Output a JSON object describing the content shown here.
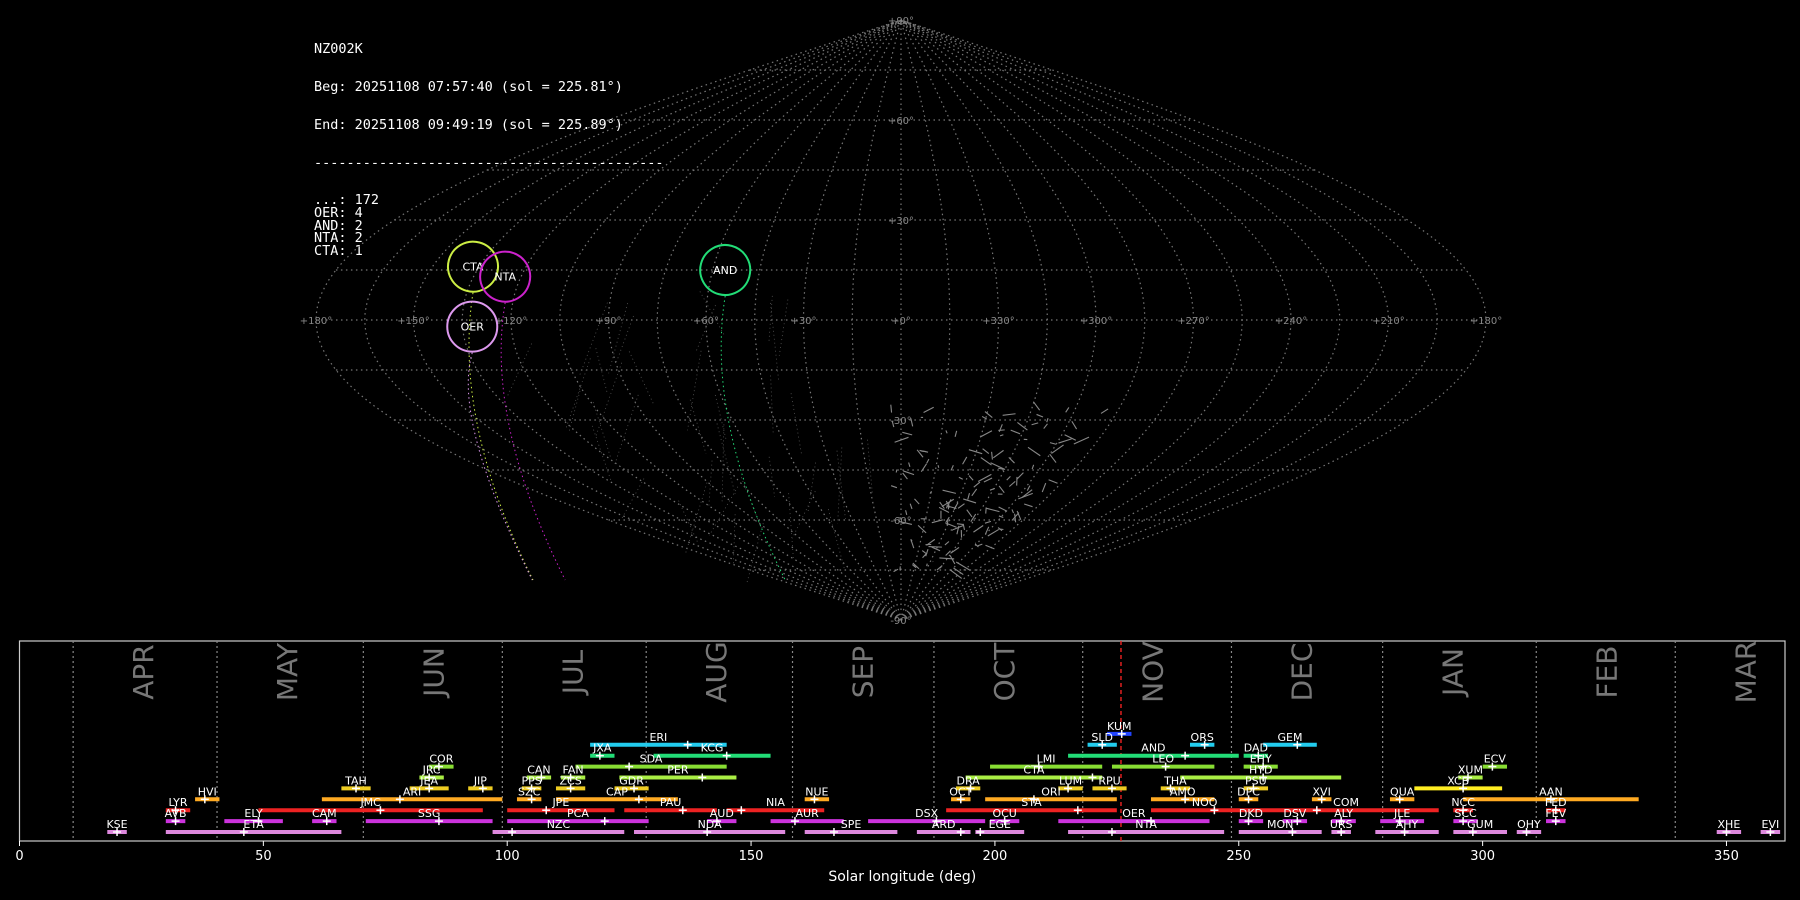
{
  "info": {
    "station": "NZ002K",
    "begin": "Beg: 20251108 07:57:40 (sol = 225.81°)",
    "end": "End: 20251108 09:49:19 (sol = 225.89°)",
    "separator": "-------------------------------------------",
    "counts": [
      {
        "code": "...",
        "count": 172
      },
      {
        "code": "OER",
        "count": 4
      },
      {
        "code": "AND",
        "count": 2
      },
      {
        "code": "NTA",
        "count": 2
      },
      {
        "code": "CTA",
        "count": 1
      }
    ]
  },
  "chart_data": [
    {
      "type": "scatter",
      "projection": "sinusoidal",
      "title": "",
      "lon_tick_labels": [
        "+180°",
        "+150°",
        "+120°",
        "+90°",
        "+60°",
        "+30°",
        "+0°",
        "+330°",
        "+300°",
        "+270°",
        "+240°",
        "+210°",
        "+180°"
      ],
      "lat_tick_labels": [
        "+90°",
        "+60°",
        "+30°",
        "-30°",
        "-60°",
        "-90°"
      ],
      "radiants": [
        {
          "code": "CTA",
          "lon": 137,
          "lat": 16,
          "color": "#ccee44"
        },
        {
          "code": "NTA",
          "lon": 125,
          "lat": 13,
          "color": "#cc22cc"
        },
        {
          "code": "AND",
          "lon": 56,
          "lat": 15,
          "color": "#22dd77"
        },
        {
          "code": "OER",
          "lon": 132,
          "lat": -2,
          "color": "#dd99ee"
        }
      ],
      "grid": true
    },
    {
      "type": "timeline",
      "xlabel": "Solar longitude (deg)",
      "xlim": [
        0,
        362
      ],
      "x_ticks": [
        0,
        50,
        100,
        150,
        200,
        250,
        300,
        350
      ],
      "current_sol": 225.85,
      "months": [
        {
          "name": "APR",
          "start": 11
        },
        {
          "name": "MAY",
          "start": 40.5
        },
        {
          "name": "JUN",
          "start": 70.5
        },
        {
          "name": "JUL",
          "start": 99
        },
        {
          "name": "AUG",
          "start": 128.5
        },
        {
          "name": "SEP",
          "start": 158.5
        },
        {
          "name": "OCT",
          "start": 187.5
        },
        {
          "name": "NOV",
          "start": 218
        },
        {
          "name": "DEC",
          "start": 248.5
        },
        {
          "name": "JAN",
          "start": 279.5
        },
        {
          "name": "FEB",
          "start": 311
        },
        {
          "name": "MAR",
          "start": 339.5
        }
      ],
      "showers": [
        {
          "code": "KUM",
          "start": 223,
          "end": 228,
          "peak": 226,
          "row": 13,
          "color": "#2244ff"
        },
        {
          "code": "ERI",
          "start": 117,
          "end": 145,
          "peak": 137,
          "row": 12,
          "color": "#22ccee"
        },
        {
          "code": "SLD",
          "start": 219,
          "end": 225,
          "peak": 222,
          "row": 12,
          "color": "#22ccee"
        },
        {
          "code": "ORS",
          "start": 240,
          "end": 245,
          "peak": 243,
          "row": 12,
          "color": "#22ccee"
        },
        {
          "code": "GEM",
          "start": 255,
          "end": 266,
          "peak": 262,
          "row": 12,
          "color": "#22ccee"
        },
        {
          "code": "JXA",
          "start": 117,
          "end": 122,
          "peak": 119,
          "row": 11,
          "color": "#22dd77"
        },
        {
          "code": "KCG",
          "start": 130,
          "end": 154,
          "peak": 145,
          "row": 11,
          "color": "#22dd77"
        },
        {
          "code": "AND",
          "start": 215,
          "end": 250,
          "peak": 239,
          "row": 11,
          "color": "#22dd77"
        },
        {
          "code": "DAD",
          "start": 251,
          "end": 256,
          "peak": 254,
          "row": 11,
          "color": "#22dd77"
        },
        {
          "code": "COR",
          "start": 84,
          "end": 89,
          "peak": 86,
          "row": 10,
          "color": "#88dd33"
        },
        {
          "code": "SDA",
          "start": 114,
          "end": 145,
          "peak": 125,
          "row": 10,
          "color": "#88dd33"
        },
        {
          "code": "LMI",
          "start": 199,
          "end": 222,
          "peak": 209,
          "row": 10,
          "color": "#88dd33"
        },
        {
          "code": "LEO",
          "start": 224,
          "end": 245,
          "peak": 235,
          "row": 10,
          "color": "#88dd33"
        },
        {
          "code": "EHY",
          "start": 251,
          "end": 258,
          "peak": 255,
          "row": 10,
          "color": "#88dd33"
        },
        {
          "code": "ECV",
          "start": 300,
          "end": 305,
          "peak": 302,
          "row": 10,
          "color": "#88dd33"
        },
        {
          "code": "JRC",
          "start": 82,
          "end": 87,
          "peak": 84,
          "row": 9,
          "color": "#aaee44"
        },
        {
          "code": "CAN",
          "start": 104,
          "end": 109,
          "peak": 107,
          "row": 9,
          "color": "#aaee44"
        },
        {
          "code": "FAN",
          "start": 111,
          "end": 116,
          "peak": 113,
          "row": 9,
          "color": "#aaee44"
        },
        {
          "code": "PER",
          "start": 123,
          "end": 147,
          "peak": 140,
          "row": 9,
          "color": "#aaee44"
        },
        {
          "code": "CTA",
          "start": 194,
          "end": 222,
          "peak": 220,
          "row": 9,
          "color": "#aaee44"
        },
        {
          "code": "HYD",
          "start": 238,
          "end": 271,
          "peak": 255,
          "row": 9,
          "color": "#aaee44"
        },
        {
          "code": "XUM",
          "start": 295,
          "end": 300,
          "peak": 297,
          "row": 9,
          "color": "#aaee44"
        },
        {
          "code": "TAH",
          "start": 66,
          "end": 72,
          "peak": 69,
          "row": 8,
          "color": "#eecc22"
        },
        {
          "code": "JEA",
          "start": 80,
          "end": 88,
          "peak": 84,
          "row": 8,
          "color": "#eecc22"
        },
        {
          "code": "JIP",
          "start": 92,
          "end": 97,
          "peak": 95,
          "row": 8,
          "color": "#eecc22"
        },
        {
          "code": "PPS",
          "start": 103,
          "end": 107,
          "peak": 105,
          "row": 8,
          "color": "#eecc22"
        },
        {
          "code": "ZCS",
          "start": 110,
          "end": 116,
          "peak": 113,
          "row": 8,
          "color": "#eecc22"
        },
        {
          "code": "GDR",
          "start": 122,
          "end": 129,
          "peak": 126,
          "row": 8,
          "color": "#eecc22"
        },
        {
          "code": "DRA",
          "start": 192,
          "end": 197,
          "peak": 195,
          "row": 8,
          "color": "#eecc22"
        },
        {
          "code": "LUM",
          "start": 213,
          "end": 218,
          "peak": 215,
          "row": 8,
          "color": "#eecc22"
        },
        {
          "code": "RPU",
          "start": 220,
          "end": 227,
          "peak": 224,
          "row": 8,
          "color": "#eecc22"
        },
        {
          "code": "THA",
          "start": 234,
          "end": 240,
          "peak": 236,
          "row": 8,
          "color": "#eecc22"
        },
        {
          "code": "PSU",
          "start": 251,
          "end": 256,
          "peak": 253,
          "row": 8,
          "color": "#eecc22"
        },
        {
          "code": "XCB",
          "start": 286,
          "end": 304,
          "peak": 296,
          "row": 8,
          "color": "#ffee22"
        },
        {
          "code": "HVI",
          "start": 36,
          "end": 41,
          "peak": 38,
          "row": 7,
          "color": "#ffaa22"
        },
        {
          "code": "ARI",
          "start": 62,
          "end": 99,
          "peak": 78,
          "row": 7,
          "color": "#ffaa22"
        },
        {
          "code": "SZC",
          "start": 102,
          "end": 107,
          "peak": 105,
          "row": 7,
          "color": "#ffaa22"
        },
        {
          "code": "CAP",
          "start": 110,
          "end": 135,
          "peak": 127,
          "row": 7,
          "color": "#ffaa22"
        },
        {
          "code": "NUE",
          "start": 161,
          "end": 166,
          "peak": 163,
          "row": 7,
          "color": "#ffaa22"
        },
        {
          "code": "OCT",
          "start": 191,
          "end": 195,
          "peak": 193,
          "row": 7,
          "color": "#ffaa22"
        },
        {
          "code": "ORI",
          "start": 198,
          "end": 225,
          "peak": 208,
          "row": 7,
          "color": "#ffaa22"
        },
        {
          "code": "AMO",
          "start": 232,
          "end": 245,
          "peak": 239,
          "row": 7,
          "color": "#ffaa22"
        },
        {
          "code": "DPC",
          "start": 250,
          "end": 254,
          "peak": 252,
          "row": 7,
          "color": "#ffaa22"
        },
        {
          "code": "XVI",
          "start": 265,
          "end": 269,
          "peak": 267,
          "row": 7,
          "color": "#ffaa22"
        },
        {
          "code": "QUA",
          "start": 281,
          "end": 286,
          "peak": 283,
          "row": 7,
          "color": "#ffaa22"
        },
        {
          "code": "AAN",
          "start": 296,
          "end": 332,
          "peak": 314,
          "row": 7,
          "color": "#ffaa22"
        },
        {
          "code": "LYR",
          "start": 30,
          "end": 35,
          "peak": 32,
          "row": 6,
          "color": "#ee2222"
        },
        {
          "code": "JMC",
          "start": 49,
          "end": 95,
          "peak": 74,
          "row": 6,
          "color": "#ee2222"
        },
        {
          "code": "JPE",
          "start": 100,
          "end": 122,
          "peak": 108,
          "row": 6,
          "color": "#ee2222"
        },
        {
          "code": "PAU",
          "start": 124,
          "end": 143,
          "peak": 136,
          "row": 6,
          "color": "#ee2222"
        },
        {
          "code": "NIA",
          "start": 145,
          "end": 165,
          "peak": 148,
          "row": 6,
          "color": "#ee2222"
        },
        {
          "code": "STA",
          "start": 190,
          "end": 225,
          "peak": 217,
          "row": 6,
          "color": "#ee2222"
        },
        {
          "code": "NOO",
          "start": 232,
          "end": 254,
          "peak": 245,
          "row": 6,
          "color": "#ee2222"
        },
        {
          "code": "COM",
          "start": 253,
          "end": 291,
          "peak": 266,
          "row": 6,
          "color": "#ee2222"
        },
        {
          "code": "NCC",
          "start": 294,
          "end": 298,
          "peak": 296,
          "row": 6,
          "color": "#ee2222"
        },
        {
          "code": "FED",
          "start": 313,
          "end": 317,
          "peak": 315,
          "row": 6,
          "color": "#ee2222"
        },
        {
          "code": "AVB",
          "start": 30,
          "end": 34,
          "peak": 32,
          "row": 5,
          "color": "#cc33dd"
        },
        {
          "code": "ELY",
          "start": 42,
          "end": 54,
          "peak": 49,
          "row": 5,
          "color": "#cc33dd"
        },
        {
          "code": "CAM",
          "start": 60,
          "end": 65,
          "peak": 63,
          "row": 5,
          "color": "#cc33dd"
        },
        {
          "code": "SSG",
          "start": 71,
          "end": 97,
          "peak": 86,
          "row": 5,
          "color": "#cc33dd"
        },
        {
          "code": "PCA",
          "start": 100,
          "end": 129,
          "peak": 120,
          "row": 5,
          "color": "#cc33dd"
        },
        {
          "code": "AUD",
          "start": 141,
          "end": 147,
          "peak": 143,
          "row": 5,
          "color": "#cc33dd"
        },
        {
          "code": "AUR",
          "start": 154,
          "end": 169,
          "peak": 159,
          "row": 5,
          "color": "#cc33dd"
        },
        {
          "code": "DSX",
          "start": 174,
          "end": 198,
          "peak": 188,
          "row": 5,
          "color": "#cc33dd"
        },
        {
          "code": "OCU",
          "start": 199,
          "end": 205,
          "peak": 202,
          "row": 5,
          "color": "#cc33dd"
        },
        {
          "code": "OER",
          "start": 213,
          "end": 244,
          "peak": 232,
          "row": 5,
          "color": "#cc33dd"
        },
        {
          "code": "DKD",
          "start": 250,
          "end": 255,
          "peak": 252,
          "row": 5,
          "color": "#cc33dd"
        },
        {
          "code": "DSV",
          "start": 259,
          "end": 264,
          "peak": 262,
          "row": 5,
          "color": "#cc33dd"
        },
        {
          "code": "ALY",
          "start": 269,
          "end": 274,
          "peak": 271,
          "row": 5,
          "color": "#cc33dd"
        },
        {
          "code": "JLE",
          "start": 279,
          "end": 288,
          "peak": 283,
          "row": 5,
          "color": "#cc33dd"
        },
        {
          "code": "SCC",
          "start": 294,
          "end": 299,
          "peak": 296,
          "row": 5,
          "color": "#cc33dd"
        },
        {
          "code": "FEV",
          "start": 313,
          "end": 317,
          "peak": 315,
          "row": 5,
          "color": "#cc33dd"
        },
        {
          "code": "KSE",
          "start": 18,
          "end": 22,
          "peak": 20,
          "row": 4,
          "color": "#dd88dd"
        },
        {
          "code": "ETA",
          "start": 30,
          "end": 66,
          "peak": 46,
          "row": 4,
          "color": "#dd88dd"
        },
        {
          "code": "NZC",
          "start": 97,
          "end": 124,
          "peak": 101,
          "row": 4,
          "color": "#dd88dd"
        },
        {
          "code": "NDA",
          "start": 126,
          "end": 157,
          "peak": 141,
          "row": 4,
          "color": "#dd88dd"
        },
        {
          "code": "SPE",
          "start": 161,
          "end": 180,
          "peak": 167,
          "row": 4,
          "color": "#dd88dd"
        },
        {
          "code": "ARD",
          "start": 184,
          "end": 195,
          "peak": 193,
          "row": 4,
          "color": "#dd88dd"
        },
        {
          "code": "EGE",
          "start": 196,
          "end": 206,
          "peak": 197,
          "row": 4,
          "color": "#dd88dd"
        },
        {
          "code": "NTA",
          "start": 215,
          "end": 247,
          "peak": 224,
          "row": 4,
          "color": "#dd88dd"
        },
        {
          "code": "MON",
          "start": 250,
          "end": 267,
          "peak": 261,
          "row": 4,
          "color": "#dd88dd"
        },
        {
          "code": "URS",
          "start": 269,
          "end": 273,
          "peak": 271,
          "row": 4,
          "color": "#dd88dd"
        },
        {
          "code": "AHY",
          "start": 278,
          "end": 291,
          "peak": 284,
          "row": 4,
          "color": "#dd88dd"
        },
        {
          "code": "GUM",
          "start": 294,
          "end": 305,
          "peak": 298,
          "row": 4,
          "color": "#dd88dd"
        },
        {
          "code": "OHY",
          "start": 307,
          "end": 312,
          "peak": 309,
          "row": 4,
          "color": "#dd88dd"
        },
        {
          "code": "XHE",
          "start": 348,
          "end": 353,
          "peak": 350,
          "row": 4,
          "color": "#dd88dd"
        },
        {
          "code": "EVI",
          "start": 357,
          "end": 361,
          "peak": 359,
          "row": 4,
          "color": "#dd88dd"
        }
      ]
    }
  ]
}
